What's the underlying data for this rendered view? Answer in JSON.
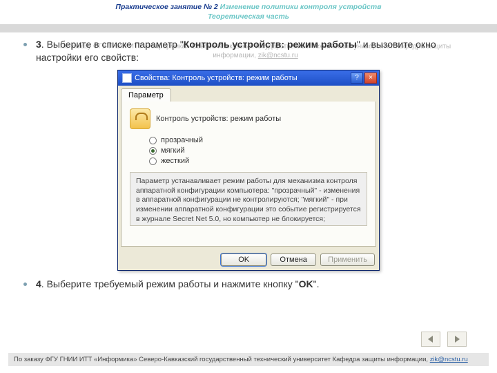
{
  "header": {
    "prefix": "Практическое занятие № 2",
    "title": "Изменение политики контроля устройств",
    "subtitle": "Теоретическая часть"
  },
  "ghost": {
    "text": "По заказу ФГУ ГНИИ ИТТ «Информика» Северо-Кавказский государственный технический университет Кафедра защиты информации,",
    "email": "zik@ncstu.ru"
  },
  "steps": {
    "s3_num": "3",
    "s3_a": ". Выберите в списке параметр \"",
    "s3_b": "Контроль устройств: режим работы",
    "s3_c": "\" и вызовите окно настройки его свойств:",
    "s4_num": "4",
    "s4_a": ". Выберите требуемый режим работы и нажмите кнопку \"",
    "s4_b": "OK",
    "s4_c": "\"."
  },
  "dialog": {
    "title": "Свойства: Контроль устройств: режим работы",
    "help_glyph": "?",
    "close_glyph": "×",
    "tab": "Параметр",
    "param_title": "Контроль устройств: режим работы",
    "options": {
      "o1": "прозрачный",
      "o2": "мягкий",
      "o3": "жесткий"
    },
    "selected": "o2",
    "description": "Параметр устанавливает режим работы для механизма контроля аппаратной конфигурации компьютера:\n\"прозрачный\" - изменения в аппаратной конфигурации не контролируются;\n\"мягкий\" - при изменении аппаратной конфигурации это событие регистрируется в журнале Secret Net 5.0, но компьютер не блокируется;",
    "buttons": {
      "ok": "OK",
      "cancel": "Отмена",
      "apply": "Применить"
    }
  },
  "footer": {
    "text": "По заказу ФГУ ГНИИ ИТТ «Информика» Северо-Кавказский государственный технический университет Кафедра защиты информации,",
    "email": "zik@ncstu.ru"
  },
  "nav": {
    "prev": "prev",
    "next": "next"
  }
}
